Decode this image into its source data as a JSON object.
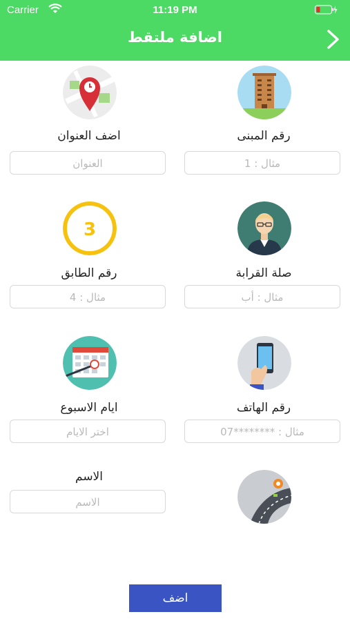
{
  "status_bar": {
    "carrier": "Carrier",
    "time": "11:19 PM"
  },
  "header": {
    "title": "اضافة ملتقط",
    "back_icon": "chevron-right-icon"
  },
  "colors": {
    "header": "#4cd964",
    "button": "#3a54c4",
    "placeholder": "#b9b9b9"
  },
  "form": {
    "building_number": {
      "label": "رقم المبنى",
      "placeholder": "مثال : 1",
      "icon": "building-icon"
    },
    "address": {
      "label": "اضف العنوان",
      "placeholder": "العنوان",
      "icon": "map-pin-icon"
    },
    "relation": {
      "label": "صلة القرابة",
      "placeholder": "مثال : أب",
      "icon": "person-avatar-icon"
    },
    "floor_number": {
      "label": "رقم الطابق",
      "placeholder": "مثال : 4",
      "icon": "floor-number-icon",
      "icon_text": "3"
    },
    "phone": {
      "label": "رقم الهاتف",
      "placeholder": "مثال : ********07",
      "icon": "phone-in-hand-icon"
    },
    "week_days": {
      "label": "ايام الاسبوع",
      "placeholder": "اختر الايام",
      "icon": "calendar-icon"
    },
    "name": {
      "label": "الاسم",
      "placeholder": "الاسم"
    },
    "route": {
      "icon": "road-route-icon"
    }
  },
  "submit_label": "اضف"
}
